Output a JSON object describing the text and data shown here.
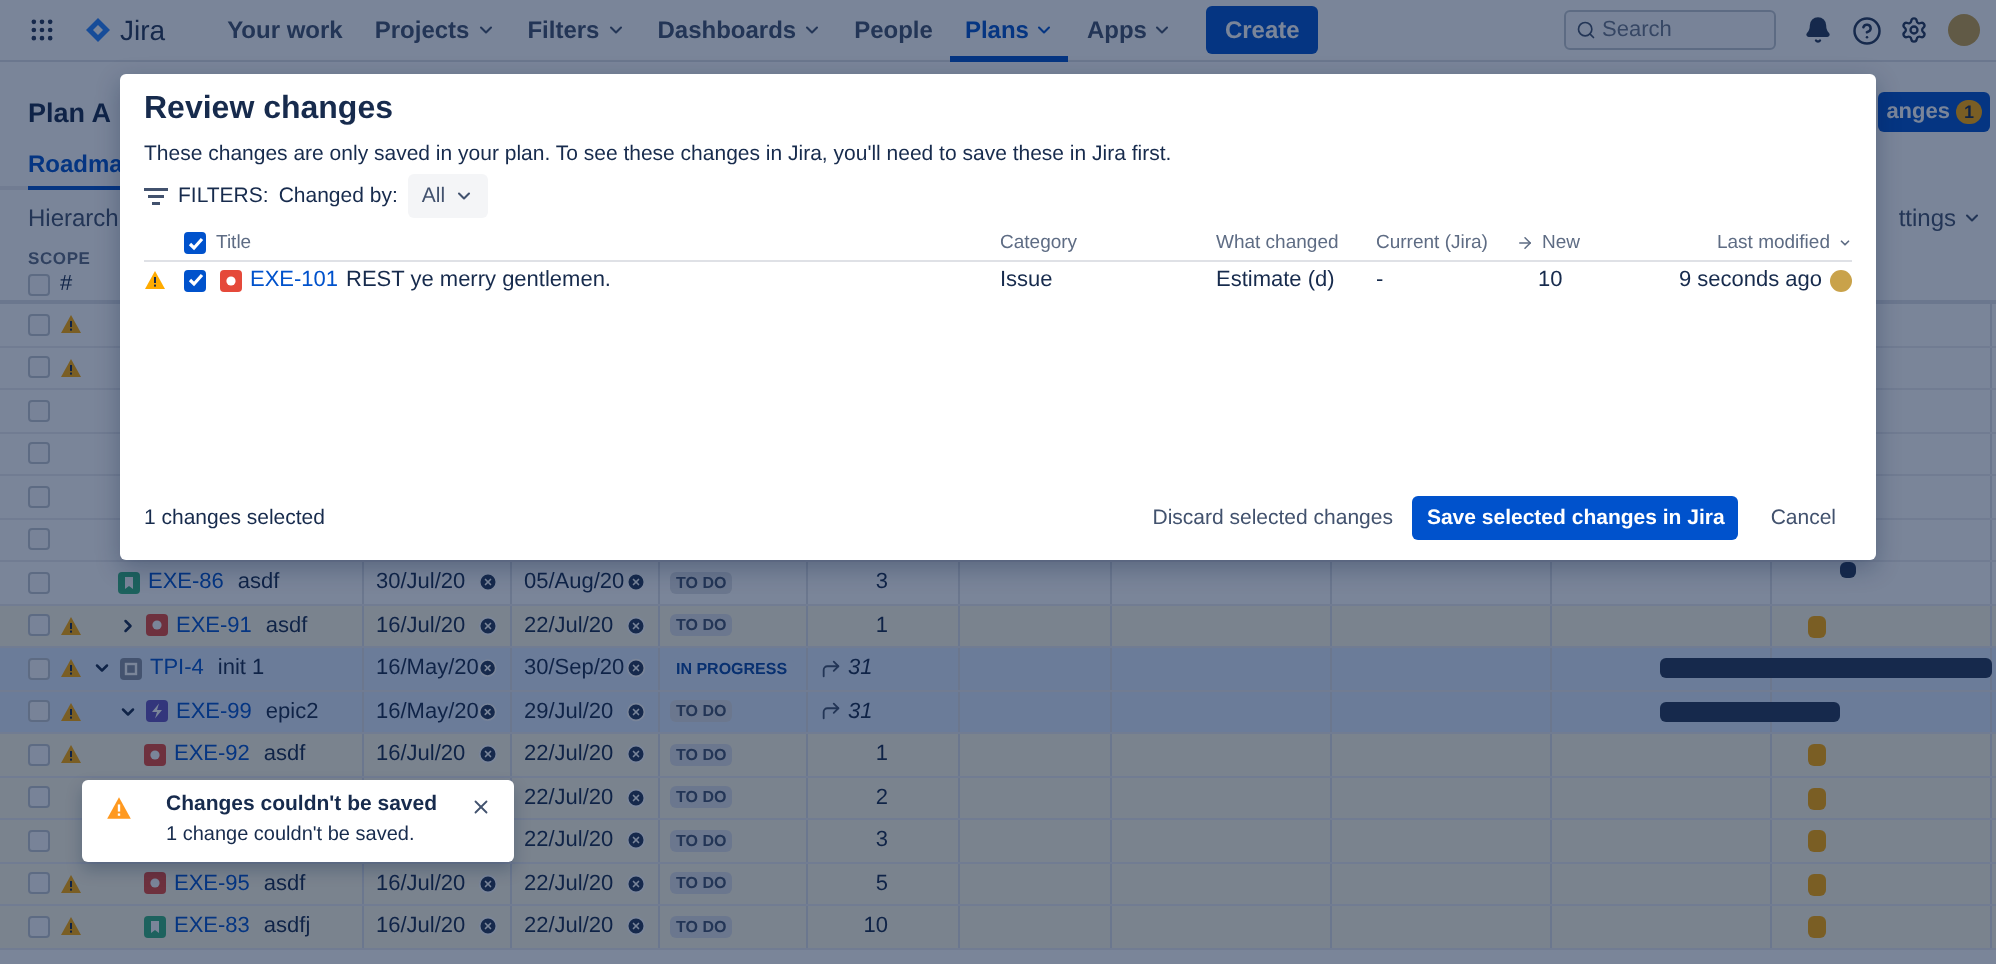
{
  "nav": {
    "logo": "Jira",
    "items": [
      {
        "label": "Your work",
        "dropdown": false,
        "selected": false
      },
      {
        "label": "Projects",
        "dropdown": true,
        "selected": false
      },
      {
        "label": "Filters",
        "dropdown": true,
        "selected": false
      },
      {
        "label": "Dashboards",
        "dropdown": true,
        "selected": false
      },
      {
        "label": "People",
        "dropdown": false,
        "selected": false
      },
      {
        "label": "Plans",
        "dropdown": true,
        "selected": true
      },
      {
        "label": "Apps",
        "dropdown": true,
        "selected": false
      }
    ],
    "create": "Create",
    "search": {
      "placeholder": "Search"
    }
  },
  "plan": {
    "title": "Plan A",
    "review_button": {
      "label": "anges",
      "badge": "1"
    },
    "tabs": [
      {
        "label": "Roadma",
        "selected": true
      }
    ],
    "hierarchy": "Hierarch",
    "settings": "ttings",
    "scope": "SCOPE",
    "all_checked": false,
    "number_header": "#"
  },
  "rows": [
    {
      "checked": false,
      "warning": true
    },
    {
      "checked": false,
      "warning": true
    },
    {
      "checked": false,
      "warning": false
    },
    {
      "checked": false,
      "warning": false
    },
    {
      "checked": false,
      "warning": false
    },
    {
      "checked": false,
      "warning": false,
      "children": [
        {
          "checked": false,
          "warning": false,
          "changed": false,
          "highlighted": false,
          "kind": "story",
          "key": "EXE-86",
          "summary": "asdf",
          "start": "30/Jul/20",
          "end": "05/Aug/20",
          "status": {
            "label": "TO DO",
            "kind": "todo"
          },
          "estimate": {
            "text": "3",
            "kind": "plain"
          },
          "timeline": {
            "kind": "tick"
          }
        },
        {
          "checked": false,
          "warning": true,
          "changed": true,
          "highlighted": false,
          "expanded": false,
          "kind": "bug",
          "key": "EXE-91",
          "summary": "asdf",
          "start": "16/Jul/20",
          "end": "22/Jul/20",
          "status": {
            "label": "TO DO",
            "kind": "todo"
          },
          "estimate": {
            "text": "1",
            "kind": "plain"
          },
          "timeline": {
            "kind": "marker"
          }
        }
      ]
    },
    {
      "checked": false,
      "warning": true,
      "changed": false,
      "highlighted": true,
      "expanded": true,
      "kind": "initiative",
      "key": "TPI-4",
      "summary": "init 1",
      "start": "16/May/20",
      "end": "30/Sep/20",
      "status": {
        "label": "IN PROGRESS",
        "kind": "inprogress"
      },
      "estimate": {
        "text": "31",
        "kind": "rollup"
      },
      "timeline": {
        "kind": "span"
      },
      "children": [
        {
          "checked": false,
          "warning": true,
          "changed": false,
          "highlighted": true,
          "expanded": true,
          "kind": "epic",
          "key": "EXE-99",
          "summary": "epic2",
          "start": "16/May/20",
          "end": "29/Jul/20",
          "status": {
            "label": "TO DO",
            "kind": "todo"
          },
          "estimate": {
            "text": "31",
            "kind": "rollup"
          },
          "timeline": {
            "kind": "short-span"
          },
          "children": [
            {
              "checked": false,
              "warning": true,
              "changed": true,
              "highlighted": false,
              "kind": "bug",
              "key": "EXE-92",
              "summary": "asdf",
              "start": "16/Jul/20",
              "end": "22/Jul/20",
              "status": {
                "label": "TO DO",
                "kind": "todo"
              },
              "estimate": {
                "text": "1",
                "kind": "plain"
              },
              "timeline": {
                "kind": "marker"
              }
            },
            {
              "checked": false,
              "changed": true,
              "highlighted": false,
              "end": "22/Jul/20",
              "status": {
                "label": "TO DO",
                "kind": "todo"
              },
              "estimate": {
                "text": "2",
                "kind": "plain"
              },
              "timeline": {
                "kind": "marker"
              }
            },
            {
              "checked": false,
              "changed": true,
              "highlighted": false,
              "end": "22/Jul/20",
              "status": {
                "label": "TO DO",
                "kind": "todo"
              },
              "estimate": {
                "text": "3",
                "kind": "plain"
              },
              "timeline": {
                "kind": "marker"
              }
            },
            {
              "checked": false,
              "warning": true,
              "changed": true,
              "highlighted": false,
              "kind": "bug",
              "key": "EXE-95",
              "summary": "asdf",
              "start": "16/Jul/20",
              "end": "22/Jul/20",
              "status": {
                "label": "TO DO",
                "kind": "todo"
              },
              "estimate": {
                "text": "5",
                "kind": "plain"
              },
              "timeline": {
                "kind": "marker"
              }
            },
            {
              "checked": false,
              "warning": true,
              "changed": true,
              "highlighted": false,
              "kind": "story",
              "key": "EXE-83",
              "summary": "asdfj",
              "start": "16/Jul/20",
              "end": "22/Jul/20",
              "status": {
                "label": "TO DO",
                "kind": "todo"
              },
              "estimate": {
                "text": "10",
                "kind": "plain"
              },
              "timeline": {
                "kind": "marker"
              }
            }
          ]
        }
      ]
    }
  ],
  "modal": {
    "title": "Review changes",
    "description": "These changes are only saved in your plan. To see these changes in Jira, you'll need to save these in Jira first.",
    "filters_label": "FILTERS:",
    "changed_by_label": "Changed by:",
    "changed_by_value": "All",
    "all_checked": true,
    "columns": [
      {
        "label": "Title",
        "kind": "plain"
      },
      {
        "label": "Category",
        "kind": "plain"
      },
      {
        "label": "What changed",
        "kind": "plain"
      },
      {
        "label": "Current (Jira)",
        "kind": "plain"
      },
      {
        "label": "New",
        "kind": "arrow"
      },
      {
        "label": "Last modified",
        "kind": "sorted"
      }
    ],
    "changes": [
      {
        "warning": true,
        "checked": true,
        "kind": "bug",
        "key": "EXE-101",
        "summary": "REST ye merry gentlemen.",
        "category": "Issue",
        "what_changed": "Estimate (d)",
        "current": "-",
        "new": "10",
        "last_modified": "9 seconds ago"
      }
    ],
    "selected_count": "1 changes selected",
    "discard": "Discard selected changes",
    "save": "Save selected changes in Jira",
    "cancel": "Cancel"
  },
  "toast": {
    "title": "Changes couldn't be saved",
    "message": "1 change couldn't be saved."
  }
}
